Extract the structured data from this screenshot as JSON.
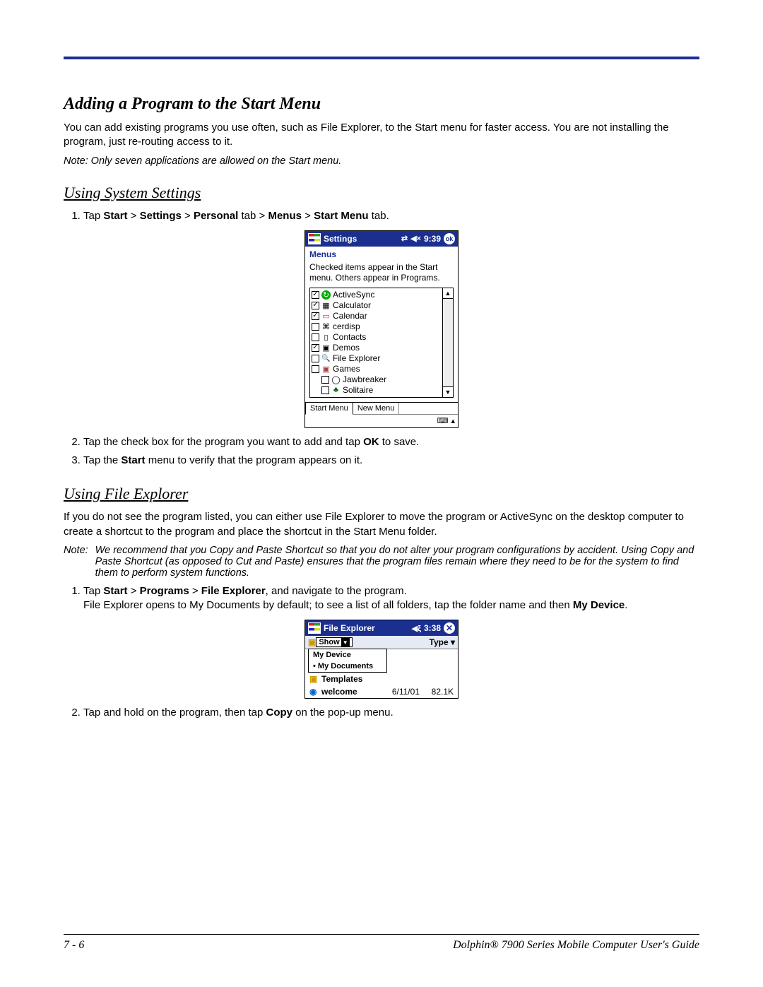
{
  "headings": {
    "h1": "Adding a Program to the Start Menu",
    "h2": "Using System Settings",
    "h3": "Using File Explorer"
  },
  "paragraphs": {
    "p1": "You can add existing programs you use often, such as File Explorer, to the Start menu for faster access. You are not installing the program, just re-routing access to it.",
    "note1": "Note:  Only seven applications are allowed on the Start menu.",
    "p2": "If you do not see the program listed, you can either use File Explorer to move the program or ActiveSync on the desktop computer to create a shortcut to the program and place the shortcut in the Start Menu folder.",
    "note2_label": "Note:",
    "note2_body": "We recommend that you Copy and Paste Shortcut so that you do not alter your program configurations by accident. Using Copy and Paste Shortcut (as opposed to Cut and Paste) ensures that the program files remain where they need to be for the system to find them to perform system functions."
  },
  "steps1": {
    "s1_prefix": "Tap ",
    "s1_b1": "Start",
    "s1_sep1": " > ",
    "s1_b2": "Settings",
    "s1_sep2": " > ",
    "s1_b3": "Personal",
    "s1_mid1": " tab > ",
    "s1_b4": "Menus",
    "s1_sep3": " > ",
    "s1_b5": "Start Menu",
    "s1_suffix": " tab.",
    "s2_a": "Tap the check box for the program you want to add and tap ",
    "s2_b": "OK",
    "s2_c": " to save.",
    "s3_a": "Tap the ",
    "s3_b": "Start",
    "s3_c": " menu to verify that the program appears on it."
  },
  "steps2": {
    "s1_a": "Tap ",
    "s1_b1": "Start",
    "s1_sep1": " > ",
    "s1_b2": "Programs",
    "s1_sep2": " > ",
    "s1_b3": "File Explorer",
    "s1_c": ", and navigate to the program.",
    "s1_line2a": "File Explorer opens to My Documents by default; to see a list of all folders, tap the folder name and then ",
    "s1_line2b": "My Device",
    "s1_line2c": ".",
    "s2_a": "Tap and hold on the program, then tap ",
    "s2_b": "Copy",
    "s2_c": " on the pop-up menu."
  },
  "settings_shot": {
    "title": "Settings",
    "time": "9:39",
    "ok": "ok",
    "menus": "Menus",
    "desc": "Checked items appear in the Start menu. Others appear in Programs.",
    "items": {
      "i0": "ActiveSync",
      "i1": "Calculator",
      "i2": "Calendar",
      "i3": "cerdisp",
      "i4": "Contacts",
      "i5": "Demos",
      "i6": "File Explorer",
      "i7": "Games",
      "i8": "Jawbreaker",
      "i9": "Solitaire"
    },
    "tab1": "Start Menu",
    "tab2": "New Menu"
  },
  "fe_shot": {
    "title": "File Explorer",
    "time": "3:38",
    "show": "Show",
    "type": "Type",
    "menu1": "My Device",
    "menu2": "• My Documents",
    "row1": "Templates",
    "row2": "welcome",
    "row2_date": "6/11/01",
    "row2_size": "82.1K"
  },
  "footer": {
    "left": "7 - 6",
    "right": "Dolphin® 7900 Series Mobile Computer User's Guide"
  }
}
